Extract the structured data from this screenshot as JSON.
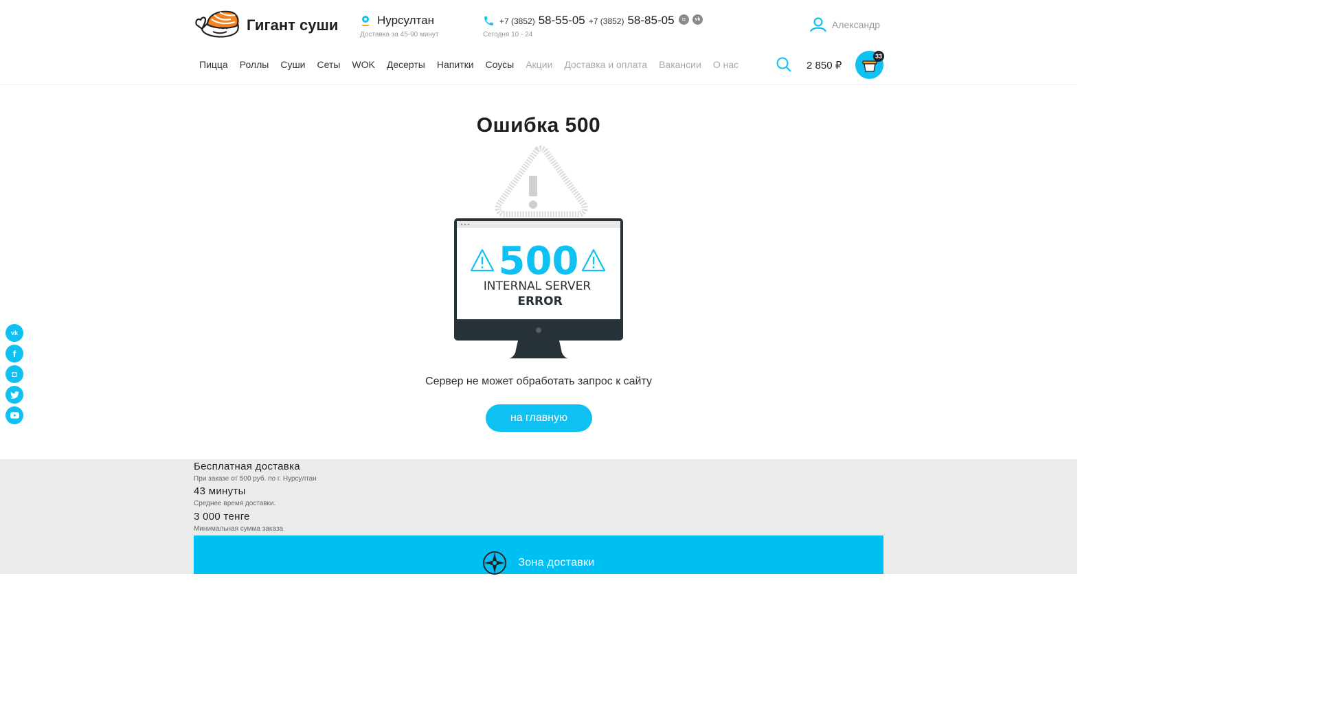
{
  "brand": {
    "name": "Гигант суши"
  },
  "location": {
    "city": "Нурсултан",
    "delivery_time": "Доставка за 45-90 минут"
  },
  "contacts": {
    "phones": [
      {
        "code": "+7 (3852)",
        "number": "58-55-05"
      },
      {
        "code": "+7 (3852)",
        "number": "58-85-05"
      }
    ],
    "hours": "Сегодня 10 - 24",
    "socials": [
      "instagram-icon",
      "vk-icon"
    ]
  },
  "user": {
    "name": "Александр"
  },
  "nav": {
    "items": [
      {
        "label": "Пицца"
      },
      {
        "label": "Роллы"
      },
      {
        "label": "Суши"
      },
      {
        "label": "Сеты"
      },
      {
        "label": "WOK"
      },
      {
        "label": "Десерты"
      },
      {
        "label": "Напитки"
      },
      {
        "label": "Соусы"
      },
      {
        "label": "Акции"
      },
      {
        "label": "Доставка и оплата"
      },
      {
        "label": "Вакансии"
      },
      {
        "label": "О нас"
      }
    ]
  },
  "cart": {
    "total": "2 850 ₽",
    "count": "33"
  },
  "error": {
    "title": "Ошибка 500",
    "code": "500",
    "line1": "INTERNAL SERVER",
    "line2": "ERROR",
    "description": "Сервер не может обработать запрос к сайту",
    "button": "на главную"
  },
  "side_social": [
    "vk-icon",
    "facebook-icon",
    "instagram-icon",
    "twitter-icon",
    "youtube-icon"
  ],
  "info": [
    {
      "title": "Бесплатная доставка",
      "subtitle": "При заказе от 500 руб. по г. Нурсултан"
    },
    {
      "title": "43 минуты",
      "subtitle": "Среднее время доставки."
    },
    {
      "title": "3 000 тенге",
      "subtitle": "Минимальная сумма заказа"
    }
  ],
  "zone": {
    "label": "Зона доставки"
  },
  "colors": {
    "accent": "#0fc0f3",
    "logo_orange": "#f58220",
    "monitor": "#263238",
    "footer_bg": "#ebebeb"
  }
}
